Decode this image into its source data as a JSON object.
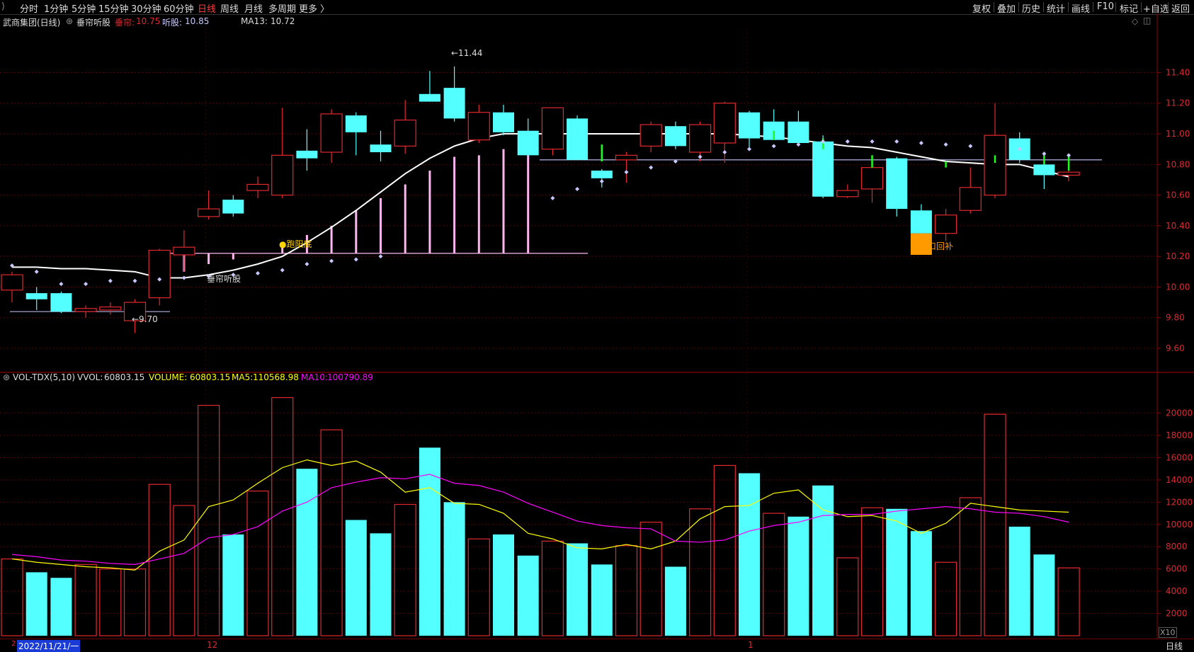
{
  "toolbar": {
    "left_items": [
      "分时",
      "1分钟",
      "5分钟",
      "15分钟",
      "30分钟",
      "60分钟",
      "日线",
      "周线",
      "月线",
      "多周期",
      "更多 〉"
    ],
    "active_index": 6,
    "right_items": [
      "复权",
      "叠加",
      "历史",
      "统计",
      "画线",
      "F10",
      "标记",
      "+自选",
      "返回"
    ]
  },
  "price_header": {
    "stock": "武商集团(日线)",
    "indicator": "垂帘听股",
    "ind_label1": "垂帘:",
    "ind_value1": "10.75",
    "ind_label2": "听股:",
    "ind_value2": "10.85",
    "ma_label": "MA13:",
    "ma_value": "10.72"
  },
  "volume_header": {
    "name": "VOL-TDX(5,10)",
    "vvol_label": "VVOL:",
    "vvol_value": "60803.15",
    "volume_label": "VOLUME:",
    "volume_value": "60803.15",
    "ma5_label": "MA5:",
    "ma5_value": "110568.98",
    "ma10_label": "MA10:",
    "ma10_value": "100790.89"
  },
  "annotations": {
    "low_label": "←9.70",
    "high_label": "←11.44",
    "indicator_name": "垂帘听股",
    "signal_label": "●跑阳底",
    "gap_label": "缺口回补"
  },
  "bottom": {
    "date": "2022/11/21/一",
    "month1": "12",
    "month2": "1",
    "period": "日线",
    "scale_unit": "X10"
  },
  "colors": {
    "up": "#e0282e",
    "down": "#54ffff",
    "ma": "#ffffff",
    "vol_ma5": "#ffff00",
    "vol_ma10": "#ff00ff",
    "marker": "#c8c8ff",
    "signal_bar": "#ffb6f0",
    "gap": "#ff9a00",
    "green_tick": "#1aff1a"
  },
  "chart_data": {
    "type": "candlestick",
    "y_ticks": [
      "11.40",
      "11.20",
      "11.00",
      "10.80",
      "10.60",
      "10.40",
      "10.20",
      "10.00",
      "9.80",
      "9.60"
    ],
    "ylim": [
      9.48,
      11.55
    ],
    "vol_ticks": [
      "20000",
      "18000",
      "16000",
      "14000",
      "12000",
      "10000",
      "8000",
      "6000",
      "4000",
      "2000"
    ],
    "vol_ylim": [
      0,
      21500
    ],
    "candles": [
      {
        "o": 9.98,
        "h": 10.1,
        "l": 9.9,
        "c": 10.08
      },
      {
        "o": 9.96,
        "h": 10.0,
        "l": 9.85,
        "c": 9.92
      },
      {
        "o": 9.96,
        "h": 9.97,
        "l": 9.83,
        "c": 9.84
      },
      {
        "o": 9.84,
        "h": 9.88,
        "l": 9.8,
        "c": 9.86
      },
      {
        "o": 9.85,
        "h": 9.9,
        "l": 9.82,
        "c": 9.87
      },
      {
        "o": 9.78,
        "h": 9.92,
        "l": 9.7,
        "c": 9.9
      },
      {
        "o": 9.93,
        "h": 10.25,
        "l": 9.88,
        "c": 10.24
      },
      {
        "o": 10.21,
        "h": 10.37,
        "l": 10.1,
        "c": 10.26
      },
      {
        "o": 10.46,
        "h": 10.63,
        "l": 10.44,
        "c": 10.51
      },
      {
        "o": 10.57,
        "h": 10.6,
        "l": 10.46,
        "c": 10.48
      },
      {
        "o": 10.63,
        "h": 10.72,
        "l": 10.58,
        "c": 10.67
      },
      {
        "o": 10.6,
        "h": 11.17,
        "l": 10.58,
        "c": 10.86
      },
      {
        "o": 10.89,
        "h": 11.03,
        "l": 10.76,
        "c": 10.84
      },
      {
        "o": 10.88,
        "h": 11.16,
        "l": 10.81,
        "c": 11.13
      },
      {
        "o": 11.12,
        "h": 11.14,
        "l": 10.86,
        "c": 11.01
      },
      {
        "o": 10.93,
        "h": 11.02,
        "l": 10.82,
        "c": 10.88
      },
      {
        "o": 10.92,
        "h": 11.22,
        "l": 10.87,
        "c": 11.09
      },
      {
        "o": 11.26,
        "h": 11.41,
        "l": 11.21,
        "c": 11.21
      },
      {
        "o": 11.3,
        "h": 11.44,
        "l": 11.08,
        "c": 11.1
      },
      {
        "o": 10.96,
        "h": 11.19,
        "l": 10.94,
        "c": 11.14
      },
      {
        "o": 11.14,
        "h": 11.19,
        "l": 10.99,
        "c": 11.01
      },
      {
        "o": 11.02,
        "h": 11.1,
        "l": 10.85,
        "c": 10.86
      },
      {
        "o": 10.9,
        "h": 11.17,
        "l": 10.86,
        "c": 11.17
      },
      {
        "o": 11.1,
        "h": 11.12,
        "l": 10.83,
        "c": 10.83
      },
      {
        "o": 10.76,
        "h": 10.77,
        "l": 10.65,
        "c": 10.71
      },
      {
        "o": 10.83,
        "h": 10.88,
        "l": 10.68,
        "c": 10.86
      },
      {
        "o": 10.92,
        "h": 11.08,
        "l": 10.88,
        "c": 11.06
      },
      {
        "o": 11.05,
        "h": 11.08,
        "l": 10.9,
        "c": 10.92
      },
      {
        "o": 10.88,
        "h": 11.08,
        "l": 10.82,
        "c": 11.06
      },
      {
        "o": 10.94,
        "h": 11.21,
        "l": 10.81,
        "c": 11.2
      },
      {
        "o": 11.14,
        "h": 11.15,
        "l": 10.91,
        "c": 10.97
      },
      {
        "o": 11.08,
        "h": 11.16,
        "l": 10.96,
        "c": 10.96
      },
      {
        "o": 11.08,
        "h": 11.15,
        "l": 10.94,
        "c": 10.94
      },
      {
        "o": 10.95,
        "h": 10.99,
        "l": 10.58,
        "c": 10.59
      },
      {
        "o": 10.59,
        "h": 10.67,
        "l": 10.58,
        "c": 10.63
      },
      {
        "o": 10.64,
        "h": 10.79,
        "l": 10.55,
        "c": 10.78
      },
      {
        "o": 10.84,
        "h": 10.85,
        "l": 10.46,
        "c": 10.51
      },
      {
        "o": 10.5,
        "h": 10.54,
        "l": 10.29,
        "c": 10.35
      },
      {
        "o": 10.35,
        "h": 10.51,
        "l": 10.3,
        "c": 10.47
      },
      {
        "o": 10.5,
        "h": 10.78,
        "l": 10.48,
        "c": 10.65
      },
      {
        "o": 10.6,
        "h": 11.2,
        "l": 10.58,
        "c": 10.99
      },
      {
        "o": 10.97,
        "h": 11.01,
        "l": 10.81,
        "c": 10.83
      },
      {
        "o": 10.8,
        "h": 10.84,
        "l": 10.64,
        "c": 10.73
      },
      {
        "o": 10.73,
        "h": 10.76,
        "l": 10.69,
        "c": 10.75
      }
    ],
    "ma13": [
      10.13,
      10.13,
      10.12,
      10.12,
      10.11,
      10.1,
      10.06,
      10.06,
      10.08,
      10.11,
      10.15,
      10.2,
      10.29,
      10.39,
      10.5,
      10.62,
      10.74,
      10.84,
      10.92,
      10.97,
      11.0,
      11.0,
      11.0,
      11.0,
      11.0,
      11.0,
      11.0,
      11.0,
      11.0,
      11.0,
      10.99,
      10.98,
      10.96,
      10.94,
      10.92,
      10.91,
      10.88,
      10.85,
      10.82,
      10.81,
      10.8,
      10.8,
      10.76,
      10.72
    ],
    "markers": [
      10.14,
      10.1,
      10.02,
      10.02,
      10.04,
      10.04,
      10.05,
      10.06,
      10.07,
      10.08,
      10.09,
      10.11,
      10.15,
      10.17,
      10.18,
      10.2,
      null,
      null,
      null,
      null,
      null,
      null,
      10.58,
      10.64,
      10.69,
      10.75,
      10.78,
      10.82,
      10.85,
      10.88,
      10.9,
      10.92,
      10.93,
      10.95,
      10.95,
      10.95,
      10.95,
      10.94,
      10.93,
      10.92,
      null,
      10.9,
      10.87,
      10.86
    ],
    "signal_bars": [
      null,
      null,
      null,
      null,
      null,
      null,
      null,
      10.1,
      10.15,
      10.18,
      10.22,
      10.26,
      10.34,
      10.4,
      10.5,
      10.58,
      10.67,
      10.76,
      10.85,
      10.86,
      10.9,
      10.91,
      null,
      null,
      null,
      null,
      null,
      null,
      null,
      null,
      null,
      null,
      null,
      null,
      null,
      null,
      null,
      null,
      null,
      null,
      null,
      null,
      null,
      null
    ],
    "volume": [
      6900,
      5700,
      5200,
      6400,
      6000,
      6000,
      13600,
      11700,
      20700,
      9100,
      13000,
      21400,
      15000,
      18500,
      10400,
      9200,
      11800,
      16900,
      12000,
      8700,
      9100,
      7200,
      8500,
      8300,
      6400,
      8100,
      10200,
      6200,
      11400,
      15300,
      14600,
      11000,
      10700,
      13500,
      7000,
      11500,
      11400,
      9400,
      6600,
      12400,
      19900,
      9800,
      7300,
      6100
    ],
    "vol_up": [
      true,
      false,
      false,
      true,
      true,
      true,
      true,
      true,
      true,
      false,
      true,
      true,
      false,
      true,
      false,
      false,
      true,
      false,
      false,
      true,
      false,
      false,
      true,
      false,
      false,
      true,
      true,
      false,
      true,
      true,
      false,
      true,
      false,
      false,
      true,
      true,
      false,
      false,
      true,
      true,
      true,
      false,
      false,
      true
    ],
    "vol_ma5": [
      6900,
      6600,
      6400,
      6200,
      6100,
      5900,
      7600,
      8600,
      11600,
      12200,
      13700,
      15100,
      15800,
      15300,
      15700,
      14700,
      12900,
      13300,
      11900,
      11800,
      11000,
      9200,
      8700,
      7900,
      7800,
      8200,
      7800,
      8500,
      10500,
      11600,
      11700,
      12800,
      13100,
      11300,
      10700,
      10800,
      10300,
      9200,
      10100,
      11900,
      11600,
      11300,
      11200,
      11100
    ],
    "vol_ma10": [
      7300,
      7100,
      6800,
      6700,
      6500,
      6400,
      6900,
      7400,
      8800,
      9100,
      9800,
      11200,
      12000,
      13300,
      13800,
      14200,
      14100,
      14500,
      13700,
      13500,
      12900,
      11900,
      11100,
      10300,
      9900,
      9700,
      9600,
      8500,
      8400,
      8600,
      9400,
      9900,
      10200,
      10800,
      10900,
      10900,
      11200,
      11400,
      11600,
      11400,
      11100,
      11000,
      10700,
      10200
    ]
  }
}
